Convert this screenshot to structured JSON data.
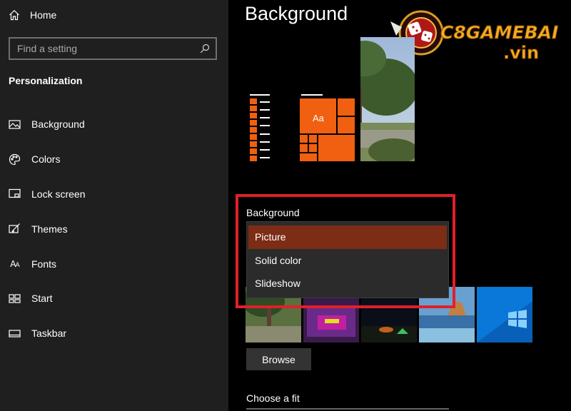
{
  "sidebar": {
    "home_label": "Home",
    "search_placeholder": "Find a setting",
    "section_title": "Personalization",
    "items": [
      {
        "label": "Background",
        "icon": "picture-icon"
      },
      {
        "label": "Colors",
        "icon": "palette-icon"
      },
      {
        "label": "Lock screen",
        "icon": "lock-screen-icon"
      },
      {
        "label": "Themes",
        "icon": "themes-icon"
      },
      {
        "label": "Fonts",
        "icon": "fonts-icon"
      },
      {
        "label": "Start",
        "icon": "start-icon"
      },
      {
        "label": "Taskbar",
        "icon": "taskbar-icon"
      }
    ]
  },
  "main": {
    "title": "Background",
    "background_label": "Background",
    "dropdown_options": [
      "Picture",
      "Solid color",
      "Slideshow"
    ],
    "selected_option": "Picture",
    "browse_label": "Browse",
    "fit_label": "Choose a fit",
    "preview_tile_label": "Aa"
  },
  "watermark": {
    "brand": "C8GAMEBAI",
    "domain": ".vin"
  },
  "colors": {
    "accent": "#f06010",
    "selected_option_bg": "#7d2c16",
    "highlight_border": "#e0202a",
    "sidebar_bg": "#1f1f1f",
    "main_bg": "#000000"
  }
}
